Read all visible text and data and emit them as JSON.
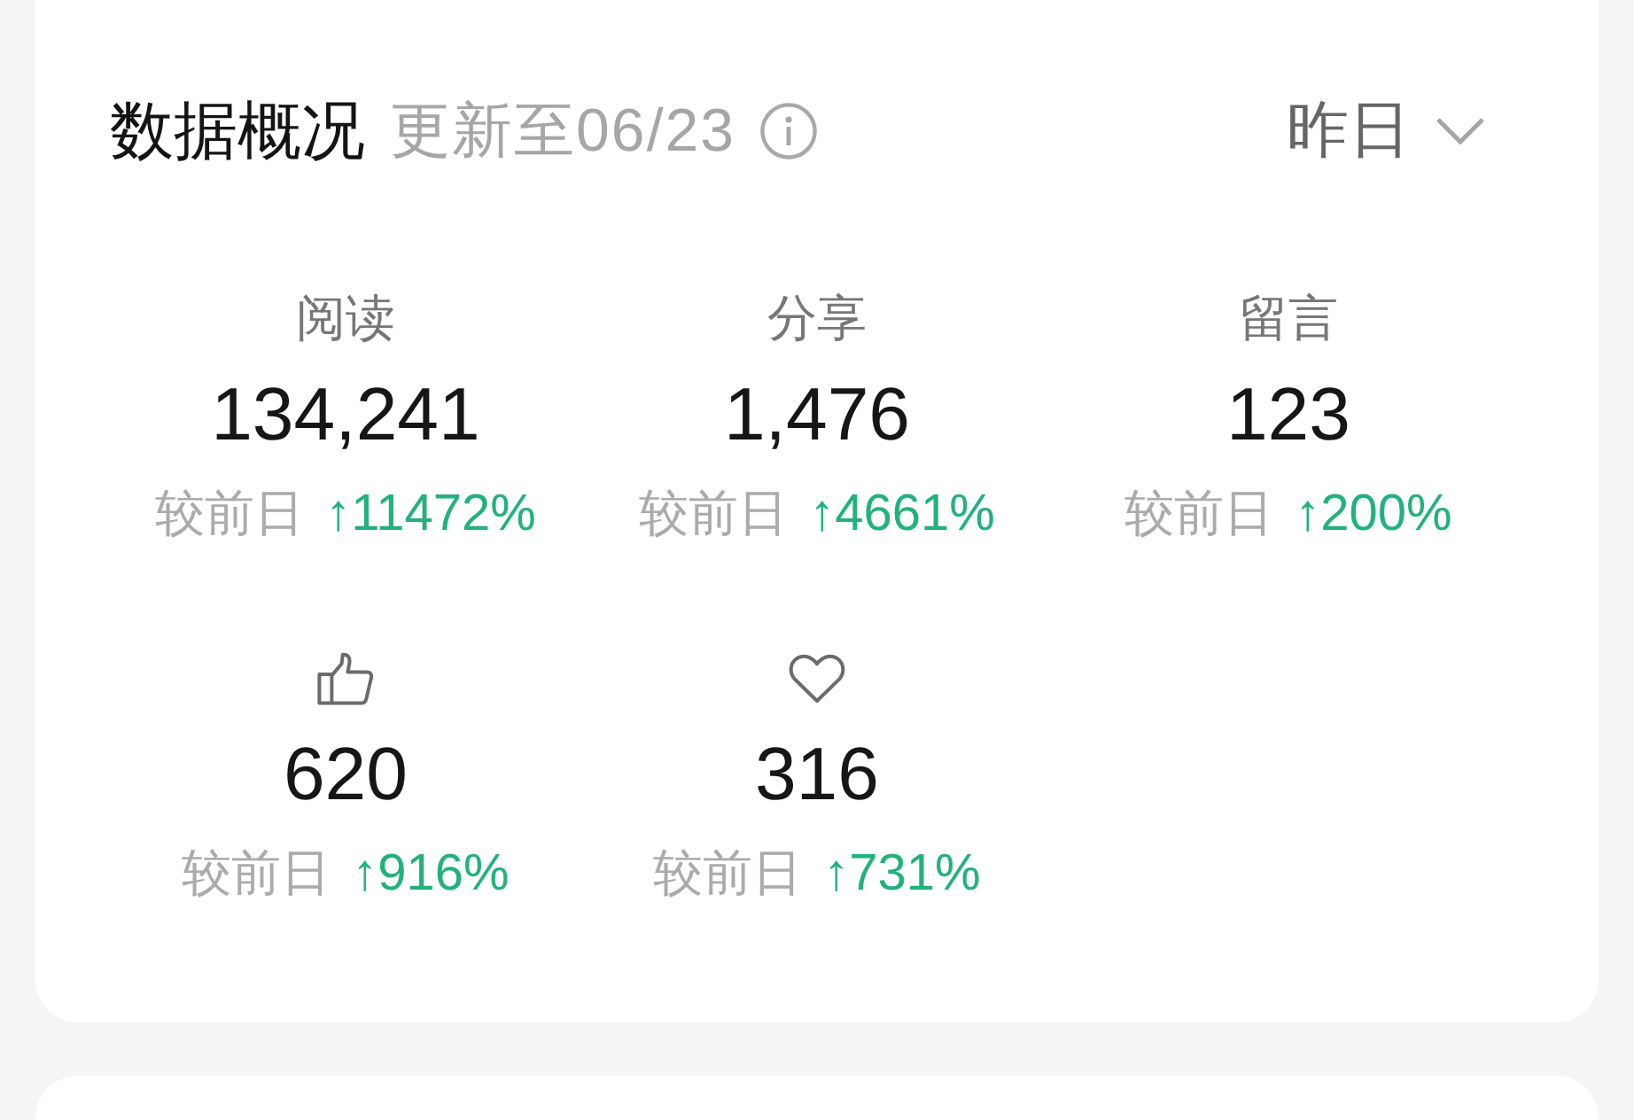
{
  "header": {
    "title": "数据概况",
    "updated": "更新至06/23",
    "period": "昨日"
  },
  "metrics": [
    {
      "kind": "text",
      "label": "阅读",
      "value": "134,241",
      "compare_label": "较前日",
      "change": "↑11472%"
    },
    {
      "kind": "text",
      "label": "分享",
      "value": "1,476",
      "compare_label": "较前日",
      "change": "↑4661%"
    },
    {
      "kind": "text",
      "label": "留言",
      "value": "123",
      "compare_label": "较前日",
      "change": "↑200%"
    },
    {
      "kind": "like",
      "value": "620",
      "compare_label": "较前日",
      "change": "↑916%"
    },
    {
      "kind": "favorite",
      "value": "316",
      "compare_label": "较前日",
      "change": "↑731%"
    }
  ]
}
